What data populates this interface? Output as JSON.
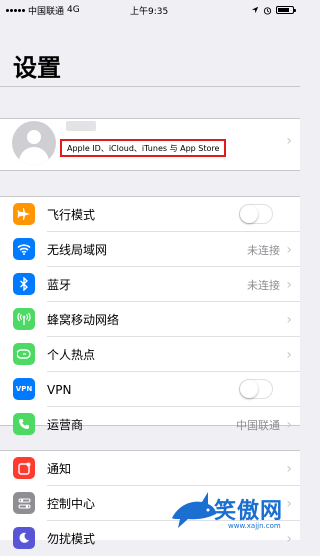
{
  "status_bar": {
    "carrier": "中国联通",
    "network": "4G",
    "time": "上午9:35"
  },
  "title": "设置",
  "profile": {
    "subtitle": "Apple ID、iCloud、iTunes 与 App Store"
  },
  "group1": [
    {
      "label": "飞行模式",
      "icon": "airplane-icon",
      "color": "#ff9500",
      "control": "toggle",
      "toggle_on": false
    },
    {
      "label": "无线局域网",
      "icon": "wifi-icon",
      "color": "#007aff",
      "value": "未连接"
    },
    {
      "label": "蓝牙",
      "icon": "bluetooth-icon",
      "color": "#007aff",
      "value": "未连接"
    },
    {
      "label": "蜂窝移动网络",
      "icon": "antenna-icon",
      "color": "#4cd964",
      "value": ""
    },
    {
      "label": "个人热点",
      "icon": "hotspot-icon",
      "color": "#4cd964",
      "value": ""
    },
    {
      "label": "VPN",
      "icon": "vpn-icon",
      "color": "#007aff",
      "control": "toggle",
      "toggle_on": false
    },
    {
      "label": "运营商",
      "icon": "phone-icon",
      "color": "#4cd964",
      "value": "中国联通"
    }
  ],
  "group2": [
    {
      "label": "通知",
      "icon": "notifications-icon",
      "color": "#ff3b30"
    },
    {
      "label": "控制中心",
      "icon": "control-center-icon",
      "color": "#8e8e93"
    },
    {
      "label": "勿扰模式",
      "icon": "moon-icon",
      "color": "#5856d6"
    }
  ],
  "watermark": {
    "text": "笑傲网",
    "url": "www.xajjn.com"
  }
}
